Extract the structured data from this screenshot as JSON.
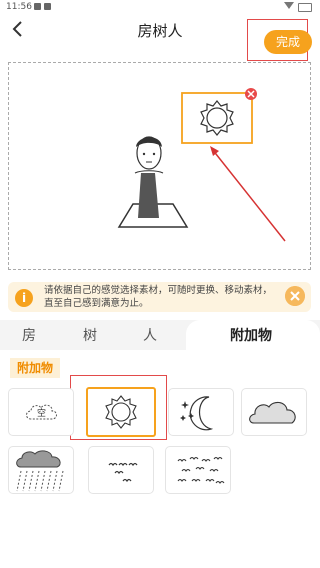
{
  "status": {
    "time": "11:56"
  },
  "header": {
    "title": "房树人",
    "done_label": "完成"
  },
  "tip": {
    "text": "请依据自己的感觉选择素材，可随时更换、移动素材，直至自己感到满意为止。"
  },
  "tabs": [
    {
      "label": "房"
    },
    {
      "label": "树"
    },
    {
      "label": "人"
    },
    {
      "label": "附加物"
    }
  ],
  "section": {
    "label": "附加物"
  },
  "items": [
    {
      "icon": "empty-cloud-icon",
      "label": "空"
    },
    {
      "icon": "sun-icon"
    },
    {
      "icon": "moon-stars-icon"
    },
    {
      "icon": "cloud-icon"
    },
    {
      "icon": "rain-cloud-icon"
    },
    {
      "icon": "birds-few-icon"
    },
    {
      "icon": "birds-many-icon"
    }
  ],
  "colors": {
    "accent": "#f6a21d",
    "highlight": "#e24a4a",
    "tip_bg": "#fdf3df"
  }
}
